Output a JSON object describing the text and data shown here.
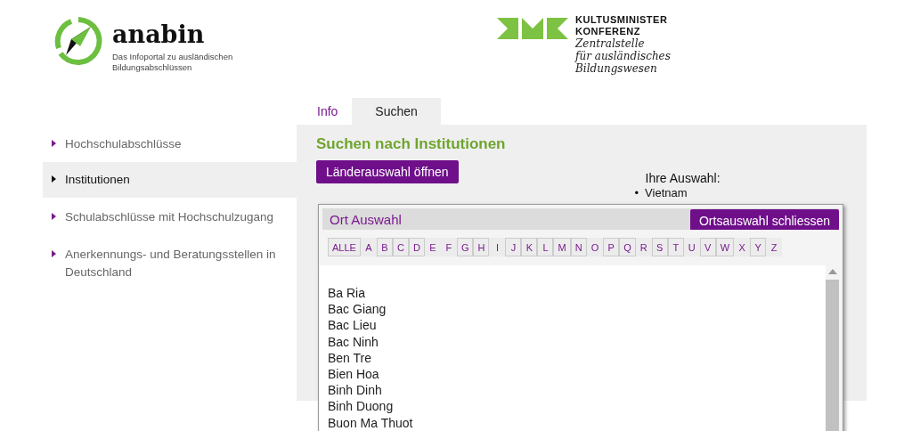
{
  "header": {
    "logo": {
      "name": "anabin",
      "tagline_lines": [
        "Das Infoportal zu ausländischen",
        "Bildungsabschlüssen"
      ]
    },
    "partner_logo": {
      "name_lines": [
        "KULTUSMINISTER",
        "KONFERENZ"
      ],
      "subtitle_lines": [
        "Zentralstelle",
        "für ausländisches",
        "Bildungswesen"
      ]
    }
  },
  "tabs": [
    {
      "label": "Info",
      "selected": false
    },
    {
      "label": "Suchen",
      "selected": true
    }
  ],
  "sidebar": {
    "items": [
      {
        "label": "Hochschulabschlüsse",
        "selected": false
      },
      {
        "label": "Institutionen",
        "selected": true
      },
      {
        "label": "Schulabschlüsse mit Hochschulzugang",
        "selected": false
      },
      {
        "label": "Anerkennungs- und Beratungsstellen in Deutschland",
        "selected": false
      }
    ]
  },
  "content": {
    "title": "Suchen nach Institutionen",
    "open_button": "Länderauswahl öffnen",
    "selection": {
      "label": "Ihre Auswahl:",
      "items": [
        {
          "marker": "•",
          "label": "Vietnam"
        }
      ]
    }
  },
  "dialog": {
    "title": "Ort Auswahl",
    "close_button": "Ortsauswahl schliessen",
    "letters": [
      {
        "label": "ALLE",
        "disabled": false
      },
      {
        "label": "A",
        "disabled": true
      },
      {
        "label": "B",
        "disabled": false
      },
      {
        "label": "C",
        "disabled": false
      },
      {
        "label": "D",
        "disabled": false
      },
      {
        "label": "E",
        "disabled": true
      },
      {
        "label": "F",
        "disabled": true
      },
      {
        "label": "G",
        "disabled": false
      },
      {
        "label": "H",
        "disabled": false
      },
      {
        "label": "I",
        "disabled": true
      },
      {
        "label": "J",
        "disabled": false
      },
      {
        "label": "K",
        "disabled": false
      },
      {
        "label": "L",
        "disabled": false
      },
      {
        "label": "M",
        "disabled": false
      },
      {
        "label": "N",
        "disabled": false
      },
      {
        "label": "O",
        "disabled": true
      },
      {
        "label": "P",
        "disabled": false
      },
      {
        "label": "Q",
        "disabled": false
      },
      {
        "label": "R",
        "disabled": true
      },
      {
        "label": "S",
        "disabled": false
      },
      {
        "label": "T",
        "disabled": false
      },
      {
        "label": "U",
        "disabled": true
      },
      {
        "label": "V",
        "disabled": false
      },
      {
        "label": "W",
        "disabled": false
      },
      {
        "label": "X",
        "disabled": true
      },
      {
        "label": "Y",
        "disabled": false
      },
      {
        "label": "Z",
        "disabled": true
      }
    ],
    "places": [
      "Ba Ria",
      "Bac Giang",
      "Bac Lieu",
      "Bac Ninh",
      "Ben Tre",
      "Bien Hoa",
      "Binh Dinh",
      "Binh Duong",
      "Buon Ma Thuot"
    ]
  }
}
